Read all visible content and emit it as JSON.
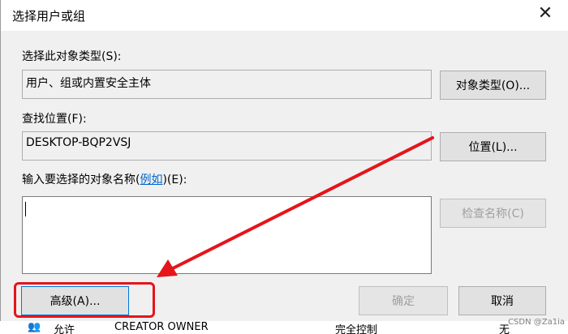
{
  "dialog": {
    "title": "选择用户或组",
    "object_type": {
      "label": "选择此对象类型(S):",
      "value": "用户、组或内置安全主体",
      "button": "对象类型(O)..."
    },
    "location": {
      "label": "查找位置(F):",
      "value": "DESKTOP-BQP2VSJ",
      "button": "位置(L)..."
    },
    "names": {
      "label_prefix": "输入要选择的对象名称(",
      "label_link": "例如",
      "label_suffix": ")(E):",
      "value": "",
      "check_button": "检查名称(C)"
    },
    "advanced_button": "高级(A)...",
    "ok_button": "确定",
    "cancel_button": "取消"
  },
  "background_row": {
    "col1": "允许",
    "col2": "CREATOR OWNER",
    "col3": "完全控制",
    "col4": "无"
  },
  "watermark": "CSDN @Za1ia"
}
